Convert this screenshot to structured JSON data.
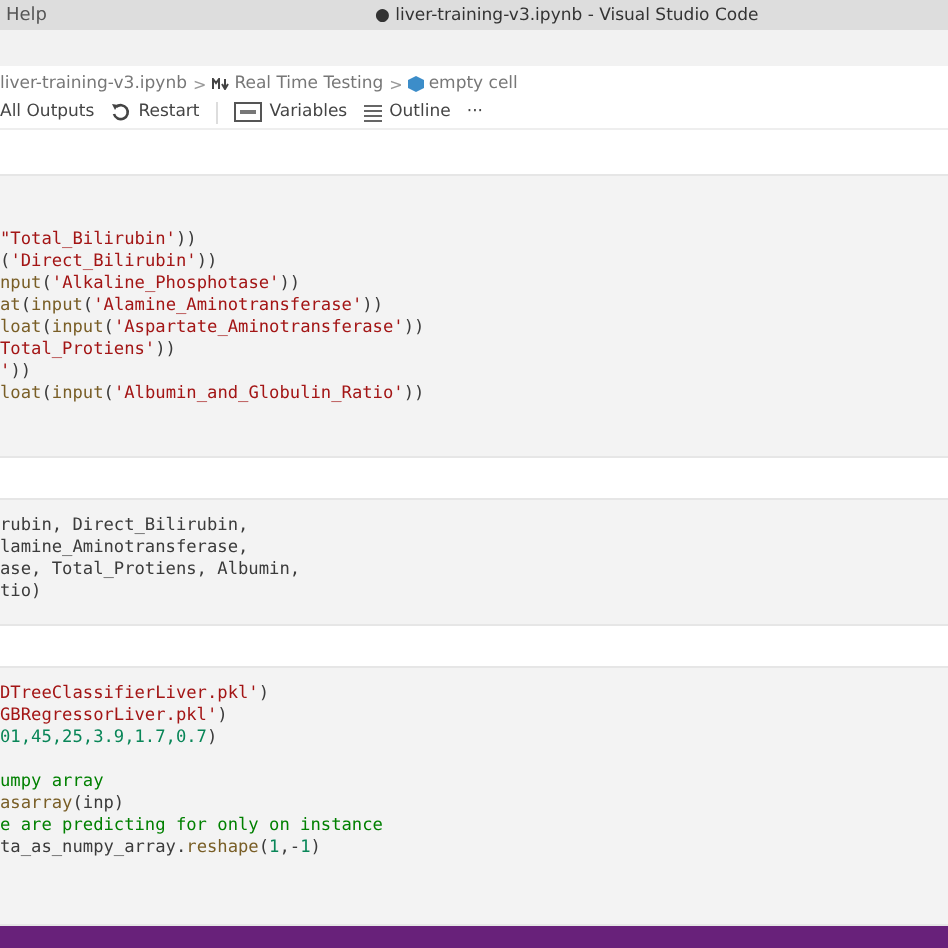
{
  "title_bar": {
    "menu": "Help",
    "title": "● liver-training-v3.ipynb - Visual Studio Code"
  },
  "breadcrumb_separator": ">",
  "breadcrumb": [
    {
      "kind": "file",
      "label": "liver-training-v3.ipynb"
    },
    {
      "kind": "markdown",
      "label": "Real Time Testing"
    },
    {
      "kind": "cell",
      "label": "empty cell"
    }
  ],
  "toolbar": [
    {
      "kind": "text",
      "label": "All Outputs"
    },
    {
      "kind": "restart",
      "label": "Restart"
    },
    {
      "kind": "variables",
      "label": "Variables"
    },
    {
      "kind": "outline",
      "label": "Outline"
    },
    {
      "kind": "more",
      "label": "···"
    }
  ],
  "cells": [
    {
      "lines": [
        [
          {
            "kind": "str",
            "text": "\"Total_Bilirubin'"
          },
          {
            "kind": "plain",
            "text": "))"
          }
        ],
        [
          {
            "kind": "plain",
            "text": "("
          },
          {
            "kind": "str",
            "text": "'Direct_Bilirubin'"
          },
          {
            "kind": "plain",
            "text": "))"
          }
        ],
        [
          {
            "kind": "func",
            "text": "nput"
          },
          {
            "kind": "plain",
            "text": "("
          },
          {
            "kind": "str",
            "text": "'Alkaline_Phosphotase'"
          },
          {
            "kind": "plain",
            "text": "))"
          }
        ],
        [
          {
            "kind": "func",
            "text": "at"
          },
          {
            "kind": "plain",
            "text": "("
          },
          {
            "kind": "func",
            "text": "input"
          },
          {
            "kind": "plain",
            "text": "("
          },
          {
            "kind": "str",
            "text": "'Alamine_Aminotransferase'"
          },
          {
            "kind": "plain",
            "text": "))"
          }
        ],
        [
          {
            "kind": "func",
            "text": "loat"
          },
          {
            "kind": "plain",
            "text": "("
          },
          {
            "kind": "func",
            "text": "input"
          },
          {
            "kind": "plain",
            "text": "("
          },
          {
            "kind": "str",
            "text": "'Aspartate_Aminotransferase'"
          },
          {
            "kind": "plain",
            "text": "))"
          }
        ],
        [
          {
            "kind": "str",
            "text": "Total_Protiens'"
          },
          {
            "kind": "plain",
            "text": "))"
          }
        ],
        [
          {
            "kind": "str",
            "text": "'"
          },
          {
            "kind": "plain",
            "text": "))"
          }
        ],
        [
          {
            "kind": "func",
            "text": "loat"
          },
          {
            "kind": "plain",
            "text": "("
          },
          {
            "kind": "func",
            "text": "input"
          },
          {
            "kind": "plain",
            "text": "("
          },
          {
            "kind": "str",
            "text": "'Albumin_and_Globulin_Ratio'"
          },
          {
            "kind": "plain",
            "text": "))"
          }
        ]
      ]
    },
    {
      "lines": [
        [
          {
            "kind": "plain",
            "text": "rubin, Direct_Bilirubin,"
          }
        ],
        [
          {
            "kind": "plain",
            "text": "lamine_Aminotransferase,"
          }
        ],
        [
          {
            "kind": "plain",
            "text": "ase, Total_Protiens, Albumin,"
          }
        ],
        [
          {
            "kind": "plain",
            "text": "tio)"
          }
        ]
      ]
    },
    {
      "lines": [
        [
          {
            "kind": "str",
            "text": "DTreeClassifierLiver.pkl'"
          },
          {
            "kind": "plain",
            "text": ")"
          }
        ],
        [
          {
            "kind": "str",
            "text": "GBRegressorLiver.pkl'"
          },
          {
            "kind": "plain",
            "text": ")"
          }
        ],
        [
          {
            "kind": "num",
            "text": "01,45,25,3.9,1.7,0.7"
          },
          {
            "kind": "plain",
            "text": ")"
          }
        ],
        {
          "kind": "blank"
        },
        [
          {
            "kind": "comment",
            "text": "umpy array"
          }
        ],
        [
          {
            "kind": "func",
            "text": "asarray"
          },
          {
            "kind": "plain",
            "text": "(inp)"
          }
        ],
        [
          {
            "kind": "comment",
            "text": "e are predicting for only on instance"
          }
        ],
        [
          {
            "kind": "plain",
            "text": "ta_as_numpy_array."
          },
          {
            "kind": "func",
            "text": "reshape"
          },
          {
            "kind": "plain",
            "text": "("
          },
          {
            "kind": "num",
            "text": "1"
          },
          {
            "kind": "plain",
            "text": ",-"
          },
          {
            "kind": "num",
            "text": "1"
          },
          {
            "kind": "plain",
            "text": ")"
          }
        ]
      ]
    }
  ]
}
